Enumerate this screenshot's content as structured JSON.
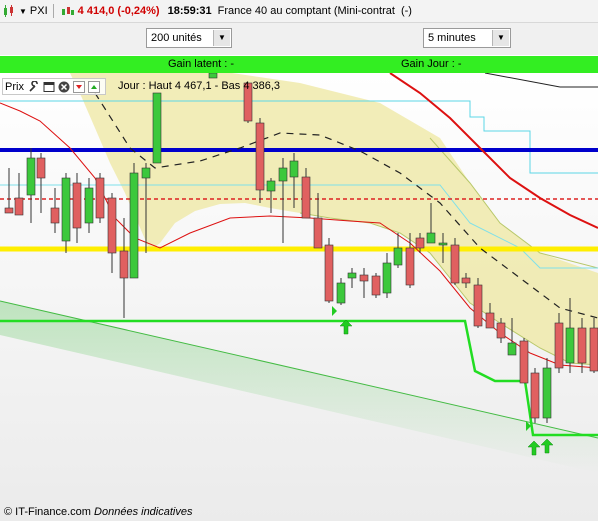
{
  "titlebar": {
    "symbol": "PXI",
    "price_change": "4 414,0 (-0,24%)",
    "time": "18:59:31",
    "instrument": "France 40 au comptant (Mini-contrat",
    "suffix": "(-)"
  },
  "toolbar": {
    "quantity": "200 unités",
    "period": "5 minutes"
  },
  "gain": {
    "latent": "Gain latent :  -",
    "jour": "Gain Jour :  -"
  },
  "chart": {
    "price_label": "Prix",
    "day_info": "Jour : Haut 4 467,1 - Bas 4 386,3"
  },
  "footer": {
    "copyright": "© IT-Finance.com",
    "note": "Données indicatives"
  },
  "colors": {
    "up_candle": "#3cc83c",
    "down_candle": "#e06060",
    "blue_line": "#0000cc",
    "yellow_line": "#ffee00",
    "green_band": "#22dd22",
    "gain_bar": "#33ee22"
  }
}
